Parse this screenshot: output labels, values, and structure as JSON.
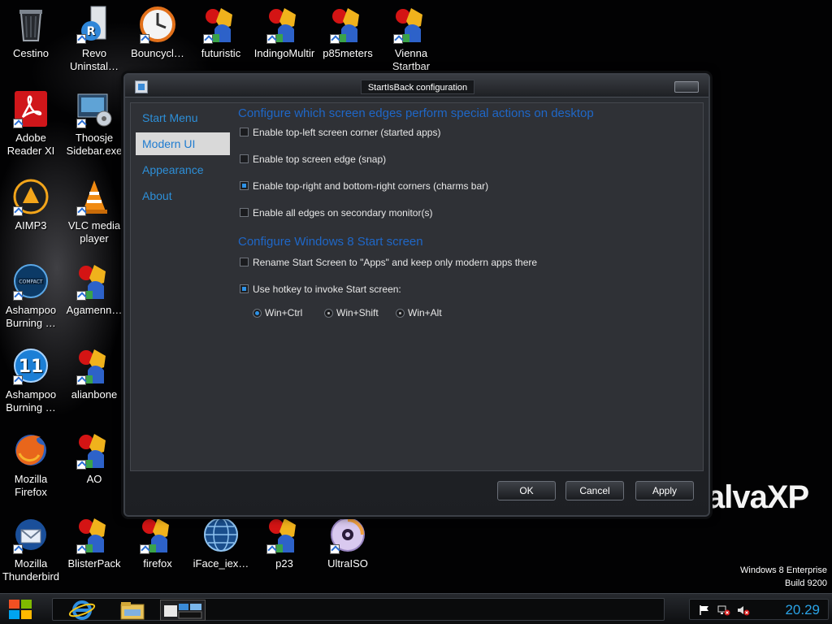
{
  "desktop": {
    "icons": [
      {
        "label": "Cestino",
        "kind": "recycle-bin-icon"
      },
      {
        "label": "Revo\nUninstal…",
        "kind": "revo-uninstaller-icon"
      },
      {
        "label": "Bouncycl…",
        "kind": "clock-icon"
      },
      {
        "label": "futuristic",
        "kind": "startbar-icon"
      },
      {
        "label": "IndingoMultir",
        "kind": "startbar-icon"
      },
      {
        "label": "p85meters",
        "kind": "startbar-icon"
      },
      {
        "label": "Vienna\nStartbar",
        "kind": "startbar-icon"
      },
      {
        "label": "Adobe\nReader XI",
        "kind": "adobe-reader-icon"
      },
      {
        "label": "Thoosje\nSidebar.exe",
        "kind": "sidebar-icon"
      },
      {
        "label": "AIMP3",
        "kind": "aimp-icon"
      },
      {
        "label": "VLC media\nplayer",
        "kind": "vlc-icon"
      },
      {
        "label": "Ashampoo\nBurning …",
        "kind": "ashampoo-compact-icon"
      },
      {
        "label": "Agamenn…",
        "kind": "startbar-icon"
      },
      {
        "label": "Ashampoo\nBurning …",
        "kind": "ashampoo-11-icon"
      },
      {
        "label": "alianbone",
        "kind": "startbar-icon"
      },
      {
        "label": "Mozilla\nFirefox",
        "kind": "firefox-icon"
      },
      {
        "label": "AO",
        "kind": "startbar-icon"
      },
      {
        "label": "Mozilla\nThunderbird",
        "kind": "thunderbird-icon"
      },
      {
        "label": "BlisterPack",
        "kind": "startbar-icon"
      },
      {
        "label": "firefox",
        "kind": "startbar-icon"
      },
      {
        "label": "iFace_iex…",
        "kind": "globe-icon"
      },
      {
        "label": "p23",
        "kind": "startbar-icon"
      },
      {
        "label": "UltraISO",
        "kind": "disc-icon"
      }
    ],
    "watermark": "alvaXP",
    "windows_edition": "Windows 8 Enterprise",
    "build": "Build 9200"
  },
  "dialog": {
    "title": "StartIsBack configuration",
    "nav": [
      "Start Menu",
      "Modern UI",
      "Appearance",
      "About"
    ],
    "active_nav": "Modern UI",
    "section1_title": "Configure which screen edges perform special actions on desktop",
    "section1_options": [
      {
        "label": "Enable top-left screen corner (started apps)",
        "checked": false
      },
      {
        "label": "Enable top screen edge (snap)",
        "checked": false
      },
      {
        "label": "Enable top-right and bottom-right corners (charms bar)",
        "checked": true
      },
      {
        "label": "Enable all edges on secondary monitor(s)",
        "checked": false
      }
    ],
    "section2_title": "Configure Windows 8 Start screen",
    "section2_options": [
      {
        "label": "Rename Start Screen to \"Apps\" and keep only modern apps there",
        "checked": false
      },
      {
        "label": "Use hotkey to invoke Start screen:",
        "checked": true
      }
    ],
    "hotkeys": [
      {
        "label": "Win+Ctrl",
        "selected": true
      },
      {
        "label": "Win+Shift",
        "selected": false
      },
      {
        "label": "Win+Alt",
        "selected": false
      }
    ],
    "buttons": {
      "ok": "OK",
      "cancel": "Cancel",
      "apply": "Apply"
    }
  },
  "taskbar": {
    "clock": "20.29",
    "pinned": [
      "internet-explorer-icon",
      "file-explorer-icon",
      "startisback-config-icon"
    ],
    "tray": [
      "flag-icon",
      "network-icon",
      "volume-muted-icon"
    ]
  },
  "colors": {
    "accent_blue": "#2d8fd8",
    "heading_blue": "#1f67c7",
    "clock_blue": "#2aa3e6"
  }
}
